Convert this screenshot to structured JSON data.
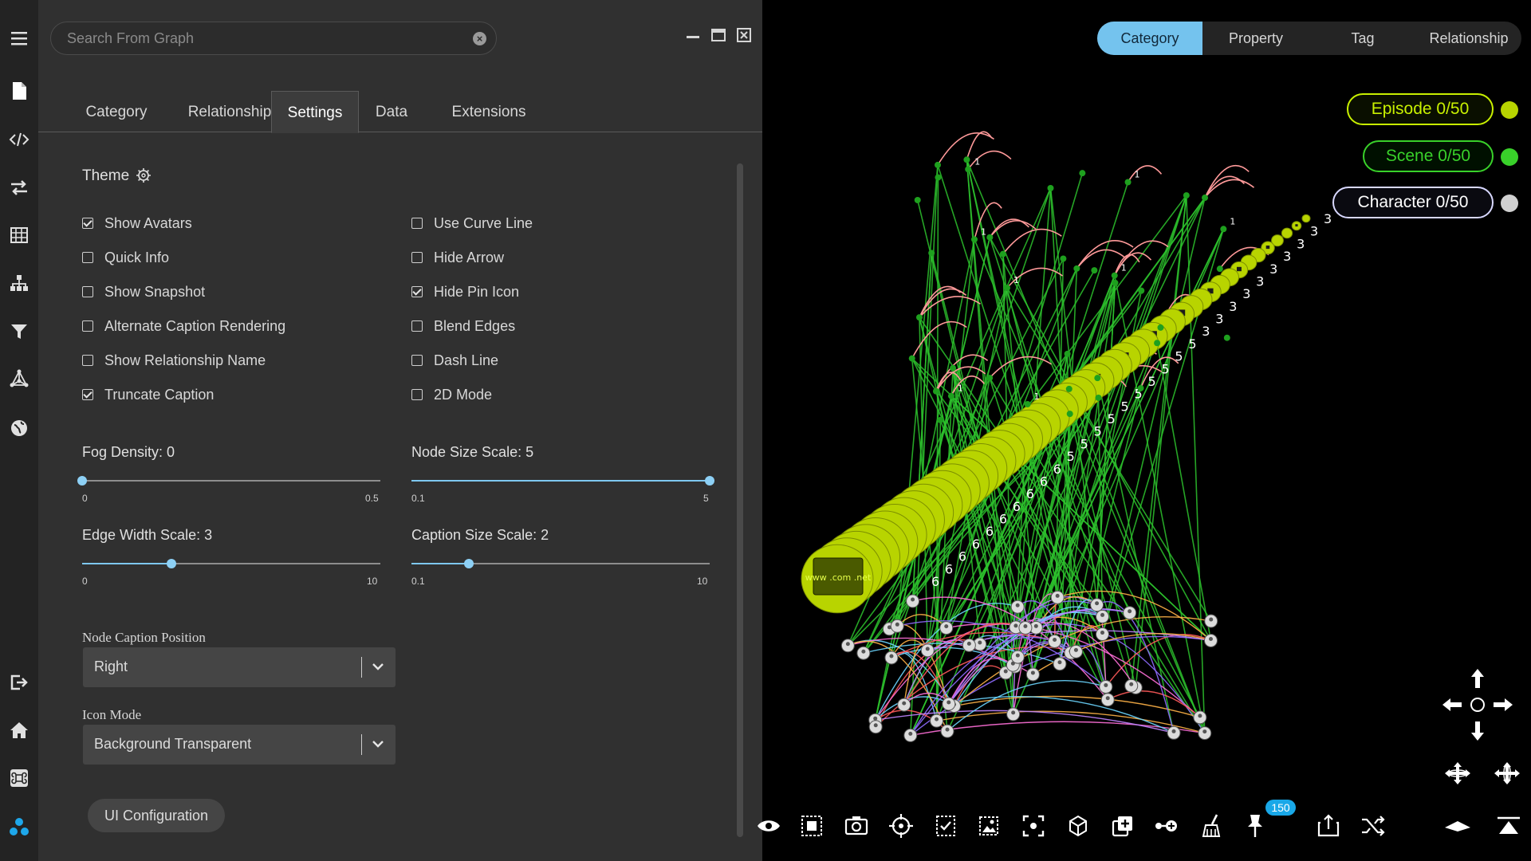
{
  "search": {
    "placeholder": "Search From Graph"
  },
  "tabs": [
    "Category",
    "Relationship",
    "Settings",
    "Data",
    "Extensions"
  ],
  "active_tab": "Settings",
  "theme": {
    "label": "Theme"
  },
  "options_left": [
    {
      "label": "Show Avatars",
      "checked": true
    },
    {
      "label": "Quick Info",
      "checked": false
    },
    {
      "label": "Show Snapshot",
      "checked": false
    },
    {
      "label": "Alternate Caption Rendering",
      "checked": false
    },
    {
      "label": "Show Relationship Name",
      "checked": false
    },
    {
      "label": "Truncate Caption",
      "checked": true
    }
  ],
  "options_right": [
    {
      "label": "Use Curve Line",
      "checked": false
    },
    {
      "label": "Hide Arrow",
      "checked": false
    },
    {
      "label": "Hide Pin Icon",
      "checked": true
    },
    {
      "label": "Blend Edges",
      "checked": false
    },
    {
      "label": "Dash Line",
      "checked": false
    },
    {
      "label": "2D Mode",
      "checked": false
    }
  ],
  "sliders": {
    "fog": {
      "label": "Fog Density: 0",
      "min": "0",
      "max": "0.5",
      "value": 0,
      "min_value": 0,
      "max_value": 0.5
    },
    "node_size": {
      "label": "Node Size Scale: 5",
      "min": "0.1",
      "max": "5",
      "value": 5,
      "min_value": 0.1,
      "max_value": 5
    },
    "edge_width": {
      "label": "Edge Width Scale: 3",
      "min": "0",
      "max": "10",
      "value": 3,
      "min_value": 0,
      "max_value": 10
    },
    "caption_size": {
      "label": "Caption Size Scale: 2",
      "min": "0.1",
      "max": "10",
      "value": 2,
      "min_value": 0.1,
      "max_value": 10
    }
  },
  "node_caption_position": {
    "label": "Node Caption Position",
    "value": "Right"
  },
  "icon_mode": {
    "label": "Icon Mode",
    "value": "Background Transparent"
  },
  "ui_config_button": "UI Configuration",
  "view_modes": [
    "Category",
    "Property",
    "Tag",
    "Relationship"
  ],
  "active_view_mode": "Category",
  "categories": [
    {
      "label": "Episode 0/50",
      "color": "#c8f000"
    },
    {
      "label": "Scene 0/50",
      "color": "#39d12a"
    },
    {
      "label": "Character 0/50",
      "color": "#ffffff"
    }
  ],
  "graph_labels": {
    "episode_number": "1",
    "scene_number": "5",
    "character_number": "6",
    "terminal_number": "3",
    "node_caption": "www .com .net"
  },
  "colors": {
    "accent": "#74c3ee",
    "episode": "#b8d400",
    "scene_edge": "#2dc22d",
    "link": "#ff9a9a"
  },
  "toolbar": {
    "icons": [
      "eye-icon",
      "select-box-icon",
      "camera-icon",
      "target-icon",
      "checklist-icon",
      "image-icon",
      "focus-icon",
      "cube-icon",
      "copy-add-icon",
      "connect-icon",
      "broom-icon",
      "pin-icon",
      "export-icon",
      "shuffle-icon",
      "flat-view-icon",
      "top-view-icon"
    ],
    "pin_badge": "150"
  }
}
